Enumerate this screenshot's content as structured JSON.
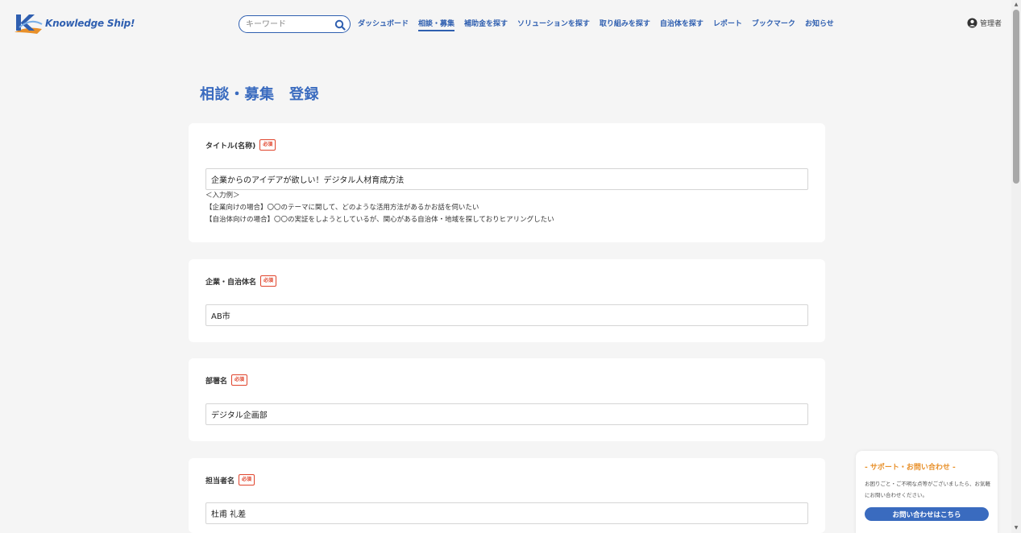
{
  "header": {
    "logo_text": "Knowledge Ship!",
    "search_placeholder": "キーワード",
    "nav": [
      {
        "label": "ダッシュボード",
        "active": false
      },
      {
        "label": "相談・募集",
        "active": true
      },
      {
        "label": "補助金を探す",
        "active": false
      },
      {
        "label": "ソリューションを探す",
        "active": false
      },
      {
        "label": "取り組みを探す",
        "active": false
      },
      {
        "label": "自治体を探す",
        "active": false
      },
      {
        "label": "レポート",
        "active": false
      },
      {
        "label": "ブックマーク",
        "active": false
      },
      {
        "label": "お知らせ",
        "active": false
      }
    ],
    "user_label": "管理者"
  },
  "page": {
    "title": "相談・募集　登録"
  },
  "required_label": "必須",
  "fields": {
    "title": {
      "label": "タイトル(名称)",
      "value": "企業からのアイデアが欲しい！デジタル人材育成方法",
      "hints": [
        "＜入力例＞",
        "【企業向けの場合】〇〇のテーマに関して、どのような活用方法があるかお話を伺いたい",
        "【自治体向けの場合】〇〇の実証をしようとしているが、関心がある自治体・地域を探しておりヒアリングしたい"
      ]
    },
    "organization": {
      "label": "企業・自治体名",
      "value": "AB市"
    },
    "department": {
      "label": "部署名",
      "value": "デジタル企画部"
    },
    "person": {
      "label": "担当者名",
      "value": "杜甫 礼差"
    }
  },
  "support": {
    "title": "- サポート・お問い合わせ -",
    "text": "お困りごと・ご不明な点等がございましたら、お気軽にお問い合わせください。",
    "button": "お問い合わせはこちら"
  },
  "colors": {
    "accent": "#2f5fb0",
    "title": "#3a6bbf",
    "required": "#e0442c",
    "support_title": "#e8902a"
  }
}
